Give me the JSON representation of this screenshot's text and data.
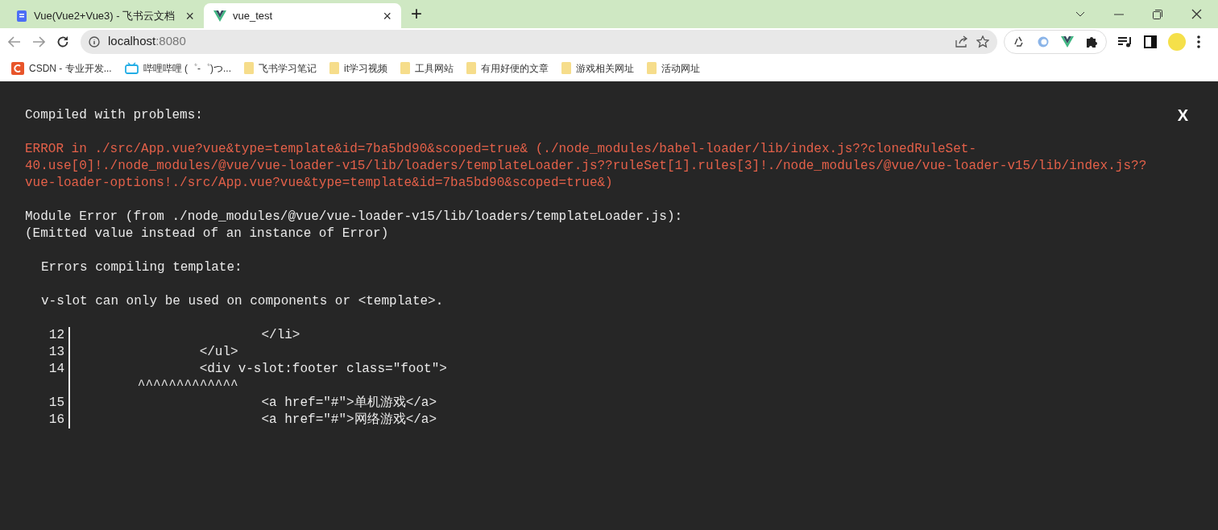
{
  "tabs": [
    {
      "title": "Vue(Vue2+Vue3) - 飞书云文档",
      "close": "×",
      "selected": false
    },
    {
      "title": "vue_test",
      "close": "×",
      "selected": true
    }
  ],
  "new_tab": "+",
  "address": {
    "host": "localhost",
    "port": ":8080"
  },
  "bookmarks": [
    {
      "label": "CSDN - 专业开发...",
      "kind": "csdn"
    },
    {
      "label": "哔哩哔哩 (゜-゜)つ...",
      "kind": "bili"
    },
    {
      "label": "飞书学习笔记",
      "kind": "folder"
    },
    {
      "label": "it学习视频",
      "kind": "folder"
    },
    {
      "label": "工具网站",
      "kind": "folder"
    },
    {
      "label": "有用好便的文章",
      "kind": "folder"
    },
    {
      "label": "游戏相关网址",
      "kind": "folder"
    },
    {
      "label": "活动网址",
      "kind": "folder"
    }
  ],
  "overlay": {
    "title": "Compiled with problems:",
    "close": "X",
    "error": "ERROR in ./src/App.vue?vue&type=template&id=7ba5bd90&scoped=true& (./node_modules/babel-loader/lib/index.js??clonedRuleSet-40.use[0]!./node_modules/@vue/vue-loader-v15/lib/loaders/templateLoader.js??ruleSet[1].rules[3]!./node_modules/@vue/vue-loader-v15/lib/index.js??vue-loader-options!./src/App.vue?vue&type=template&id=7ba5bd90&scoped=true&)",
    "module_error": [
      "Module Error (from ./node_modules/@vue/vue-loader-v15/lib/loaders/templateLoader.js):",
      "(Emitted value instead of an instance of Error)"
    ],
    "compile_heading": "Errors compiling template:",
    "message": "v-slot can only be used on components or <template>.",
    "code_lines": [
      {
        "number": "12",
        "code": "                        </li>"
      },
      {
        "number": "13",
        "code": "                </ul>"
      },
      {
        "number": "14",
        "code": "                <div v-slot:footer class=\"foot\">"
      },
      {
        "code": "        ^^^^^^^^^^^^^"
      },
      {
        "number": "15",
        "code": "                        <a href=\"#\">单机游戏</a>"
      },
      {
        "number": "16",
        "code": "                        <a href=\"#\">网络游戏</a>"
      }
    ]
  }
}
